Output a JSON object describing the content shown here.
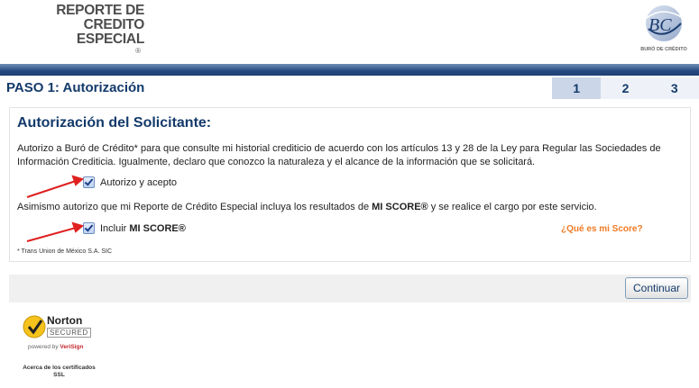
{
  "header": {
    "logo_line1": "REPORTE DE",
    "logo_line2": "CREDITO ESPECIAL",
    "logo_reg": "®",
    "buro_logo_caption": "BURÓ DE CRÉDITO"
  },
  "paso": {
    "title": "PASO 1: Autorización",
    "steps": [
      "1",
      "2",
      "3"
    ],
    "active_step": "1"
  },
  "panel": {
    "title": "Autorización del Solicitante:",
    "paragraph1": "Autorizo a Buró de Crédito* para que consulte mi historial crediticio de acuerdo con los artículos 13 y 28 de la Ley para Regular las Sociedades de Información Crediticia. Igualmente, declaro que conozco la naturaleza y el alcance de la información que se solicitará.",
    "checkbox1_label": "Autorizo y acepto",
    "paragraph2_before": "Asimismo autorizo que mi Reporte de Crédito Especial incluya los resultados de ",
    "paragraph2_bold": "MI SCORE®",
    "paragraph2_after": " y se realice el cargo por este servicio.",
    "checkbox2_label_prefix": "Incluir ",
    "checkbox2_label_bold": "MI SCORE®",
    "score_link": "¿Qué es mi Score?",
    "footnote": "* Trans Union de México S.A. SIC"
  },
  "actions": {
    "continue_label": "Continuar"
  },
  "norton": {
    "name": "Norton",
    "secured": "SECURED",
    "powered_prefix": "powered by ",
    "powered_brand": "VeriSign",
    "ssl_line1": "Acerca de los certificados",
    "ssl_line2": "SSL"
  },
  "colors": {
    "navy": "#133a6b",
    "orange_link": "#f07a24",
    "annotation_arrow": "#e02020"
  }
}
